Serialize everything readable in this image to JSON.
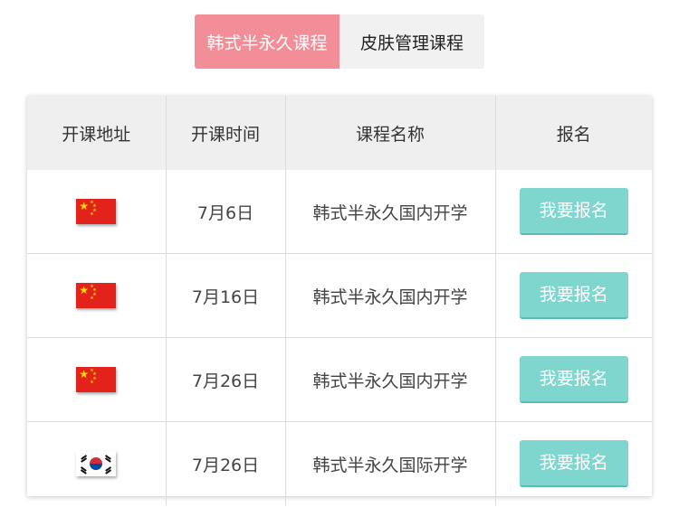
{
  "tabs": [
    {
      "label": "韩式半永久课程",
      "active": true
    },
    {
      "label": "皮肤管理课程",
      "active": false
    }
  ],
  "table": {
    "headers": [
      "开课地址",
      "开课时间",
      "课程名称",
      "报名"
    ],
    "rows": [
      {
        "flag": "china-flag-icon",
        "date": "7月6日",
        "course": "韩式半永久国内开学",
        "button": "我要报名"
      },
      {
        "flag": "china-flag-icon",
        "date": "7月16日",
        "course": "韩式半永久国内开学",
        "button": "我要报名"
      },
      {
        "flag": "china-flag-icon",
        "date": "7月26日",
        "course": "韩式半永久国内开学",
        "button": "我要报名"
      },
      {
        "flag": "korea-flag-icon",
        "date": "7月26日",
        "course": "韩式半永久国际开学",
        "button": "我要报名"
      }
    ]
  },
  "colors": {
    "active_tab": "#f28e98",
    "inactive_tab": "#f1f1f1",
    "button": "#7fd6ce",
    "header_bg": "#efefef"
  }
}
